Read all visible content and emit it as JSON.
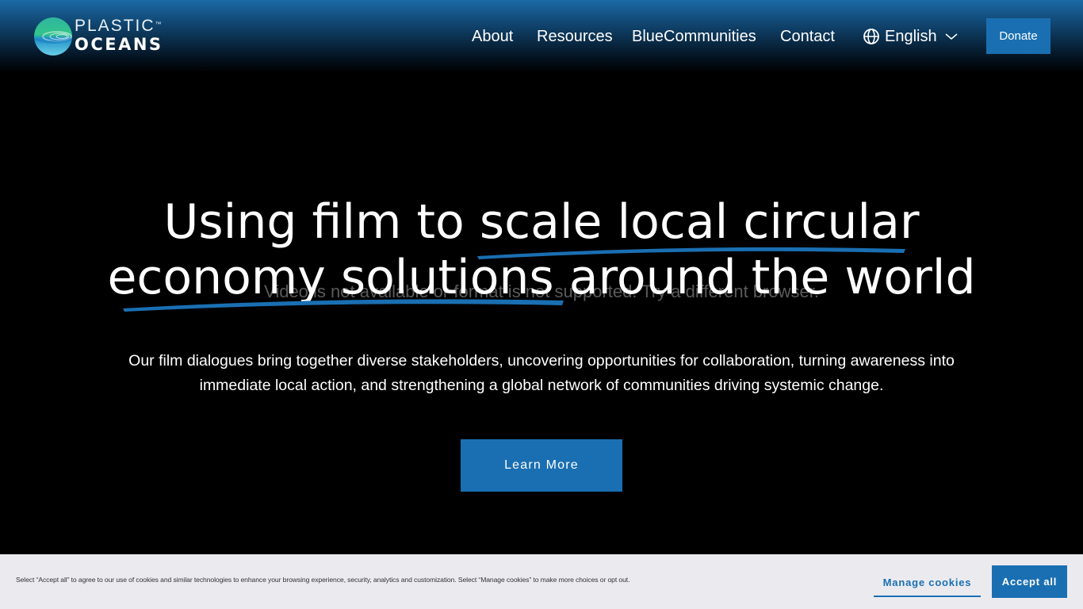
{
  "brand": {
    "logo_top": "PLASTIC",
    "logo_tm": "™",
    "logo_bottom": "OCEANS",
    "accent_color": "#1a6fb2"
  },
  "nav": {
    "items": [
      {
        "label": "About"
      },
      {
        "label": "Resources"
      },
      {
        "label": "BlueCommunities"
      },
      {
        "label": "Contact"
      }
    ],
    "language": {
      "label": "English",
      "icon": "globe-icon",
      "dropdown_icon": "chevron-down-icon"
    },
    "donate_label": "Donate"
  },
  "hero": {
    "title_line1": "Using film to scale local circular",
    "title_line2": "economy solutions around the world",
    "video_message": "Video is not available or format is not supported. Try a different browser.",
    "subtitle": "Our film dialogues bring together diverse stakeholders, uncovering opportunities for collaboration, turning awareness into immediate local action, and strengthening a global network of communities driving systemic change.",
    "cta_label": "Learn More"
  },
  "cookie_banner": {
    "text": "Select “Accept all” to agree to our use of cookies and similar technologies to enhance your browsing experience, security, analytics and customization. Select “Manage cookies” to make more choices or opt out.",
    "manage_label": "Manage cookies",
    "accept_label": "Accept all"
  }
}
